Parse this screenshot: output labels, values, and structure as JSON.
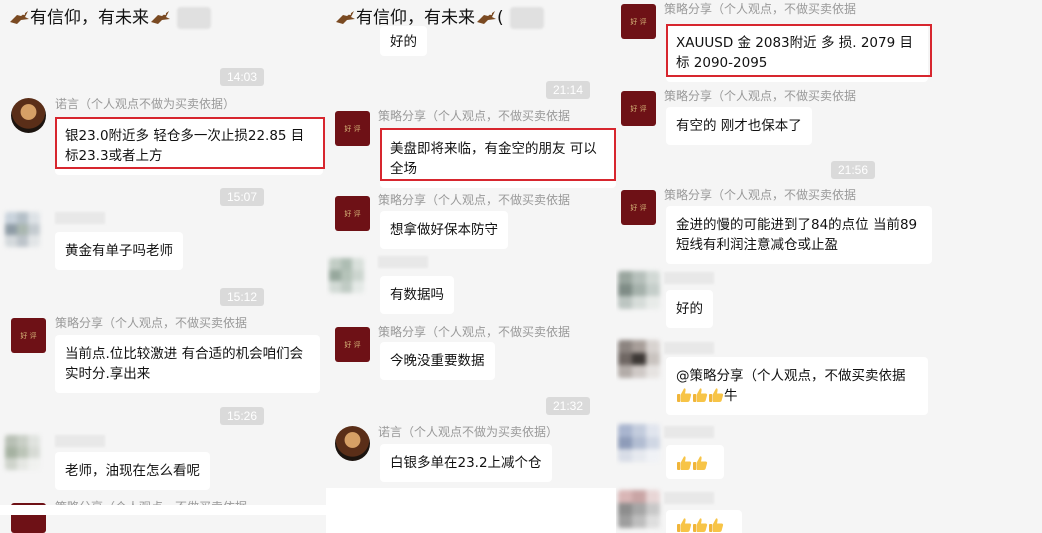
{
  "col1": {
    "title": "有信仰，有未来",
    "times": [
      "14:03",
      "15:07",
      "15:12",
      "15:26"
    ],
    "sender_nuoyan": "诺言（个人观点不做为买卖依据）",
    "sender_strategy": "策略分享（个人观点，不做买卖依据",
    "msg1": "银23.0附近多 轻仓多一次止损22.85    目标23.3或者上方",
    "msg2": "黄金有单子吗老师",
    "msg3": "当前点.位比较激进 有合适的机会咱们会实时分.享出来",
    "msg4": "老师，油现在怎么看呢",
    "partial_sender": "策略分享（个人观点，不做买卖依据"
  },
  "col2": {
    "title": "有信仰，有未来",
    "cut_top": "好的",
    "times": [
      "21:14",
      "21:32"
    ],
    "sender_strategy": "策略分享（个人观点，不做买卖依据",
    "sender_nuoyan": "诺言（个人观点不做为买卖依据）",
    "msg1": "美盘即将来临，有金空的朋友 可以全场",
    "msg2": "想拿做好保本防守",
    "msg3": "有数据吗",
    "msg4": "今晚没重要数据",
    "msg5": "白银多单在23.2上减个仓"
  },
  "col3": {
    "times": [
      "21:56"
    ],
    "sender_strategy": "策略分享（个人观点，不做买卖依据",
    "msg1": "XAUUSD 金 2083附近 多  损. 2079  目标 2090-2095",
    "msg2": "有空的 刚才也保本了",
    "msg3": "金进的慢的可能进到了84的点位 当前89短线有利润注意减仓或止盈",
    "msg4": "好的",
    "msg5_text": "@策略分享（个人观点，不做买卖依据",
    "msg5_suffix": "牛"
  },
  "avatar_text": "好 评",
  "colors": {
    "highlight": "#d7262e",
    "panel_bg": "#f5f5f5",
    "strategy_avatar": "#6e1116"
  },
  "icons": [
    "bird-emoji-icon",
    "thumbs-up-icon"
  ]
}
